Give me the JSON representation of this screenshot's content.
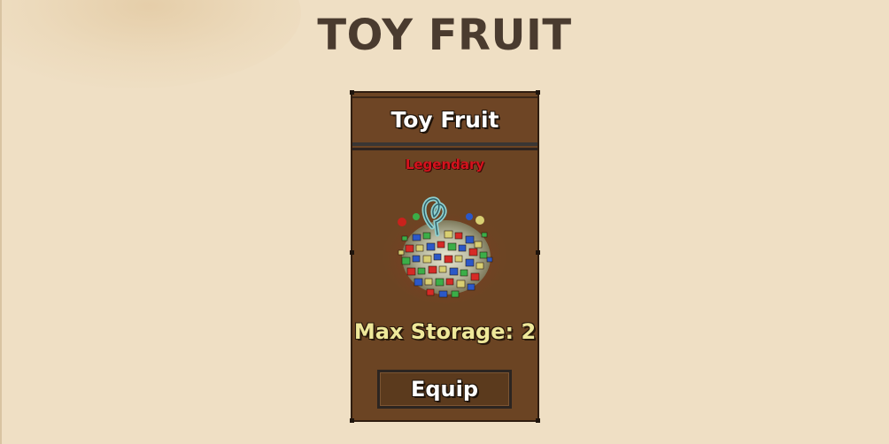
{
  "page": {
    "title": "TOY FRUIT"
  },
  "card": {
    "title": "Toy Fruit",
    "rarity": "Legendary",
    "max_storage": "Max Storage: 2",
    "equip_label": "Equip",
    "image_icon": "toy-fruit-icon"
  },
  "colors": {
    "background": "#efdfc4",
    "title_text": "#4a3b2f",
    "card_brown": "#6b4423",
    "rarity_red": "#d4121d",
    "storage_yellow": "#eee89a"
  }
}
